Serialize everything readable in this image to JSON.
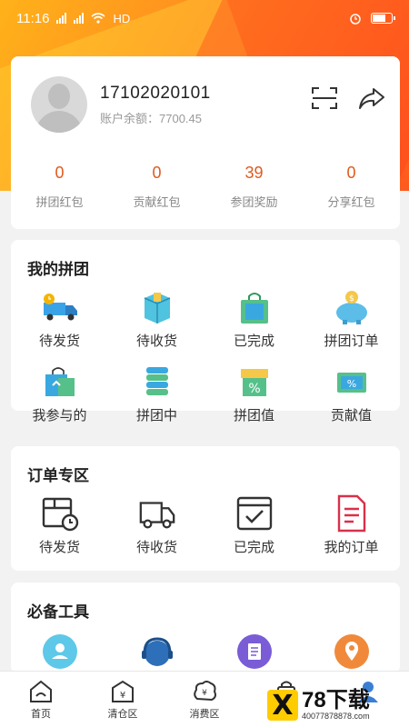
{
  "status_bar": {
    "time": "11:16",
    "network": "HD",
    "icons": [
      "signal-icon",
      "signal-icon",
      "wifi-icon",
      "alarm-icon",
      "battery-icon"
    ]
  },
  "profile": {
    "phone": "17102020101",
    "balance_label": "账户余额：7700.45",
    "icons": [
      "scan-icon",
      "share-icon"
    ]
  },
  "stats": [
    {
      "value": "0",
      "label": "拼团红包"
    },
    {
      "value": "0",
      "label": "贡献红包"
    },
    {
      "value": "39",
      "label": "参团奖励"
    },
    {
      "value": "0",
      "label": "分享红包"
    }
  ],
  "group": {
    "title": "我的拼团",
    "row1": [
      {
        "label": "待发货",
        "icon": "delivery-truck-icon"
      },
      {
        "label": "待收货",
        "icon": "package-box-icon"
      },
      {
        "label": "已完成",
        "icon": "shopping-bag-icon"
      },
      {
        "label": "拼团订单",
        "icon": "piggy-bank-icon"
      }
    ],
    "row2": [
      {
        "label": "我参与的",
        "icon": "gift-bag-icon"
      },
      {
        "label": "拼团中",
        "icon": "coin-stack-icon"
      },
      {
        "label": "拼团值",
        "icon": "percent-gift-icon"
      },
      {
        "label": "贡献值",
        "icon": "percent-card-icon"
      }
    ]
  },
  "orders": {
    "title": "订单专区",
    "items": [
      {
        "label": "待发货",
        "icon": "box-clock-icon"
      },
      {
        "label": "待收货",
        "icon": "truck-outline-icon"
      },
      {
        "label": "已完成",
        "icon": "check-box-icon"
      },
      {
        "label": "我的订单",
        "icon": "document-icon"
      }
    ]
  },
  "tools": {
    "title": "必备工具",
    "icons": [
      "profile-icon",
      "customer-service-icon",
      "notes-icon",
      "location-icon"
    ]
  },
  "tabbar": [
    {
      "label": "首页",
      "icon": "home-icon"
    },
    {
      "label": "清仓区",
      "icon": "clearance-icon"
    },
    {
      "label": "消费区",
      "icon": "consumption-icon"
    },
    {
      "label": "",
      "icon": "bag-icon"
    },
    {
      "label": "",
      "icon": "user-icon"
    }
  ],
  "watermark": {
    "brand": "78下载",
    "url": "40077878878.com"
  },
  "colors": {
    "accent": "#e05a1e",
    "brand_orange": "#ff8a1f"
  }
}
